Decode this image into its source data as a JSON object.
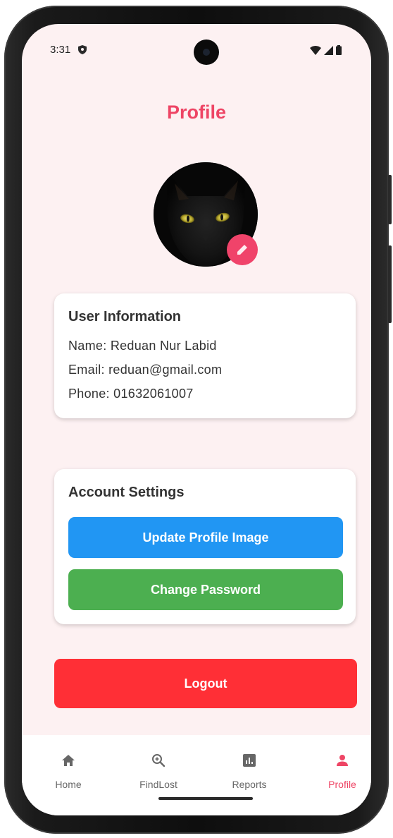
{
  "status_bar": {
    "time": "3:31",
    "shield_icon": "shield-icon",
    "wifi_icon": "wifi-icon",
    "signal_icon": "signal-icon",
    "battery_icon": "battery-icon"
  },
  "page": {
    "title": "Profile",
    "accent_color": "#ee4565"
  },
  "avatar": {
    "image_subject": "black cat",
    "edit_icon": "edit-icon"
  },
  "user_info": {
    "title": "User Information",
    "name_line": "Name: Reduan Nur Labid",
    "email_line": "Email: reduan@gmail.com",
    "phone_line": "Phone: 01632061007"
  },
  "account_settings": {
    "title": "Account Settings",
    "update_image_label": "Update Profile Image",
    "update_image_color": "#2196f3",
    "change_password_label": "Change Password",
    "change_password_color": "#4caf50"
  },
  "logout": {
    "label": "Logout",
    "color": "#ff2f36"
  },
  "bottom_nav": {
    "items": [
      {
        "label": "Home",
        "icon": "home-icon",
        "active": false
      },
      {
        "label": "FindLost",
        "icon": "search-icon",
        "active": false
      },
      {
        "label": "Reports",
        "icon": "bar-chart-icon",
        "active": false
      },
      {
        "label": "Profile",
        "icon": "person-icon",
        "active": true
      }
    ]
  }
}
